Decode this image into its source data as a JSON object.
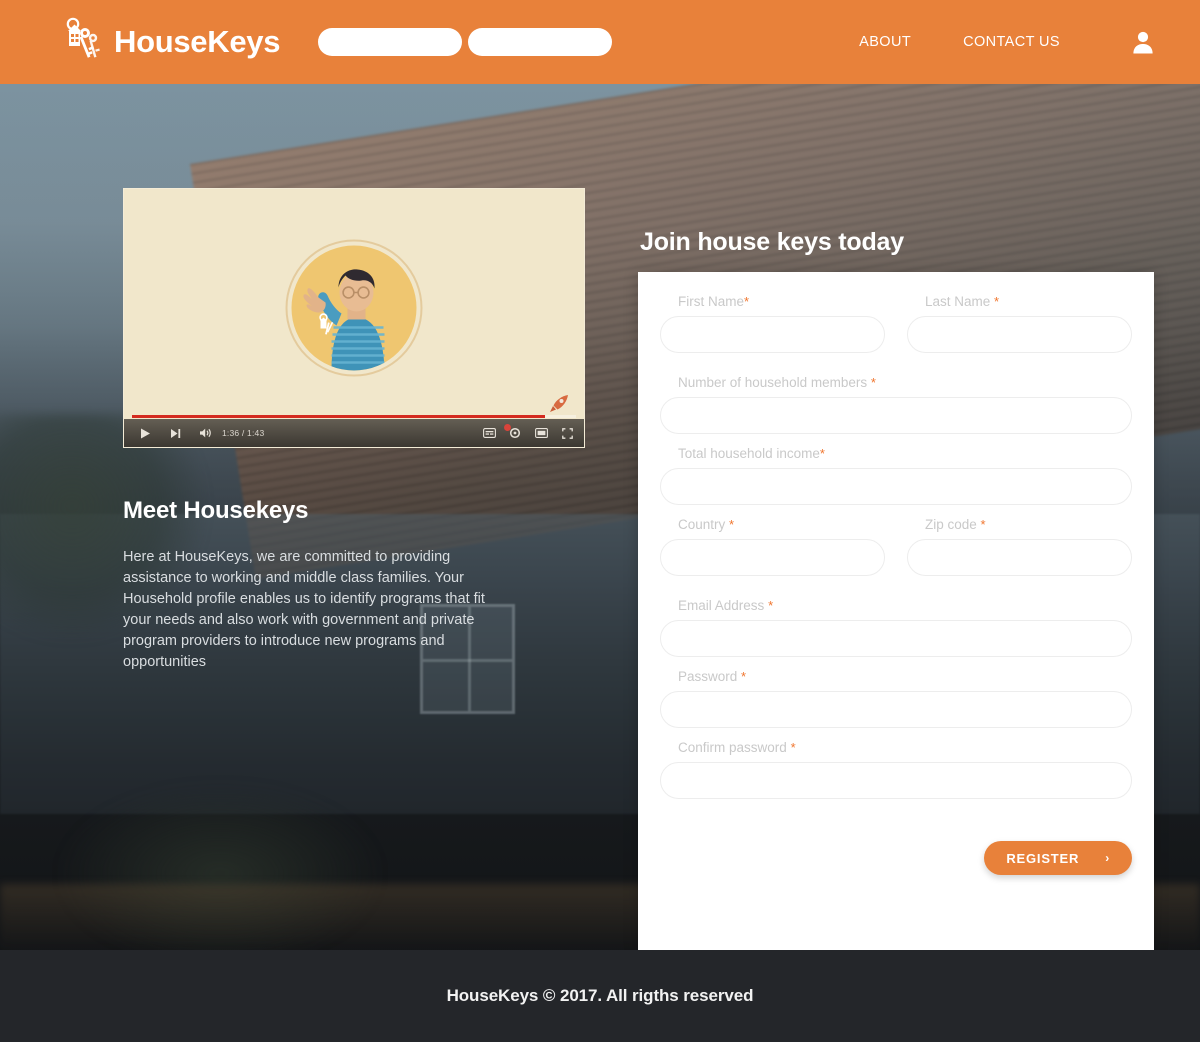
{
  "header": {
    "logo_icon": "house-keys-icon",
    "brand": "HouseKeys",
    "pills": [
      {
        "name": "nav-pill-primary",
        "value": ""
      },
      {
        "name": "nav-pill-secondary",
        "value": ""
      }
    ],
    "links": [
      {
        "label": "ABOUT"
      },
      {
        "label": "CONTACT US"
      }
    ],
    "account_icon": "user-avatar-icon",
    "bg_color": "#e8813a"
  },
  "left": {
    "video": {
      "play_icon": "play-icon",
      "next_icon": "next-track-icon",
      "volume_icon": "volume-icon",
      "time": "1:36 / 1:43",
      "current_time": "1:36",
      "duration": "1:43",
      "progress_percent": 93,
      "subtitles_icon": "subtitles-icon",
      "settings_icon": "gear-icon",
      "theater_icon": "theater-mode-icon",
      "fullscreen_icon": "fullscreen-icon",
      "overlay_icon": "rocket-icon",
      "illustration": "man-holding-keys-illustration"
    },
    "heading": "Meet Housekeys",
    "body": "Here at HouseKeys, we are committed to providing assistance to working and middle class families. Your Household profile enables us to identify programs that fit your needs and also work with government and private program providers to introduce new programs and opportunities"
  },
  "form": {
    "title": "Join house  keys today",
    "required_mark": "*",
    "fields": [
      {
        "id": "first_name",
        "label": "First Name",
        "required": true,
        "value": "",
        "placeholder": ""
      },
      {
        "id": "last_name",
        "label": "Last Name",
        "required": true,
        "value": "",
        "placeholder": ""
      },
      {
        "id": "members",
        "label": "Number of household members",
        "required": true,
        "value": "",
        "placeholder": ""
      },
      {
        "id": "income",
        "label": "Total household income",
        "required": true,
        "value": "",
        "placeholder": ""
      },
      {
        "id": "country",
        "label": "Country",
        "required": true,
        "value": "",
        "placeholder": ""
      },
      {
        "id": "zip",
        "label": "Zip code",
        "required": true,
        "value": "",
        "placeholder": ""
      },
      {
        "id": "email",
        "label": "Email Address",
        "required": true,
        "value": "",
        "placeholder": ""
      },
      {
        "id": "password",
        "label": "Password",
        "required": true,
        "value": "",
        "placeholder": ""
      },
      {
        "id": "confirm",
        "label": "Confirm password",
        "required": true,
        "value": "",
        "placeholder": ""
      }
    ],
    "submit": {
      "label": "REGISTER",
      "chevron": "›",
      "color": "#e8813a"
    }
  },
  "footer": {
    "text": "HouseKeys © 2017. All rigths reserved",
    "bg_color": "#24262a"
  },
  "colors": {
    "brand_orange": "#e8813a",
    "required_orange": "#f0762f",
    "label_gray": "#c9c9c9",
    "footer_dark": "#24262a",
    "sky_blue_gray": "#7c93a0"
  }
}
